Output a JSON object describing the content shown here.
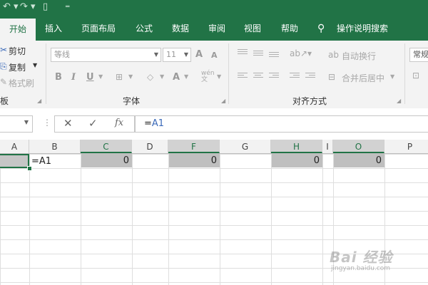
{
  "colors": {
    "brand": "#217346",
    "ribbon_bg": "#f3f3f3",
    "selection_gray": "#bfbfbf"
  },
  "titlebar": {
    "undo_icon": "undo-icon",
    "redo_icon": "redo-icon",
    "file_icon": "new-file-icon",
    "customize_icon": "customize-qat-icon"
  },
  "tabs": [
    "开始",
    "插入",
    "页面布局",
    "公式",
    "数据",
    "审阅",
    "视图",
    "帮助"
  ],
  "tell_me": {
    "icon": "lightbulb-icon",
    "label": "操作说明搜索"
  },
  "clipboard": {
    "cut": "剪切",
    "copy": "复制",
    "format_painter": "格式刷",
    "group_label": "板"
  },
  "font": {
    "name": "等线",
    "size": "11",
    "grow": "A",
    "shrink": "A",
    "bold": "B",
    "italic": "I",
    "underline": "U",
    "font_color": "A",
    "phonetic": "wén 文",
    "group_label": "字体"
  },
  "alignment": {
    "wrap": "自动换行",
    "merge": "合并后居中",
    "group_label": "对齐方式"
  },
  "number": {
    "format": "常规"
  },
  "formula_bar": {
    "cancel": "✕",
    "enter": "✓",
    "fx": "fx",
    "eq": "=",
    "ref": "A1"
  },
  "columns": [
    "A",
    "B",
    "C",
    "D",
    "F",
    "G",
    "H",
    "I",
    "O",
    "P"
  ],
  "row1": {
    "b_edit": "=A1",
    "c": "0",
    "f": "0",
    "h": "0",
    "o": "0"
  },
  "watermark": {
    "line1": "Bai 经验",
    "line2": "jingyan.baidu.com"
  }
}
